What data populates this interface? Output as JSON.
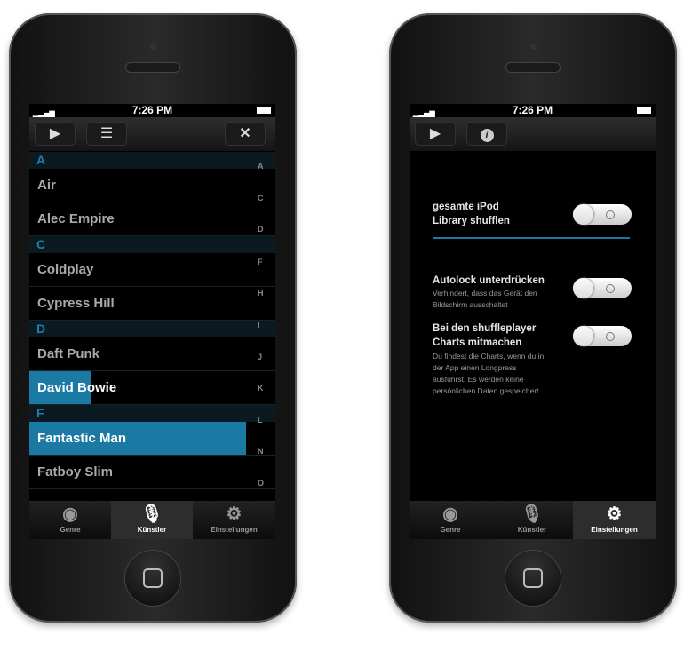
{
  "status": {
    "time": "7:26 PM"
  },
  "left": {
    "toolbar": {
      "play": "play-icon",
      "queue": "queue-icon",
      "close": "close-icon"
    },
    "headers": [
      "A",
      "C",
      "D",
      "F"
    ],
    "rows": [
      "Air",
      "Alec Empire",
      "Coldplay",
      "Cypress Hill",
      "Daft Punk",
      "David Bowie",
      "Fantastic Man",
      "Fatboy Slim"
    ],
    "index": [
      "A",
      "C",
      "D",
      "F",
      "H",
      "I",
      "J",
      "K",
      "L",
      "N",
      "O"
    ],
    "progress": {
      "David Bowie": 0.25,
      "Fantastic Man": 0.88
    },
    "accent": "#1b7aa3"
  },
  "tabs": [
    {
      "label": "Genre",
      "icon": "disc-icon"
    },
    {
      "label": "Künstler",
      "icon": "microphone-icon"
    },
    {
      "label": "Einstellungen",
      "icon": "gear-icon"
    }
  ],
  "right": {
    "settings": [
      {
        "title1": "gesamte iPod",
        "title2": "Library shufflen",
        "on": false
      },
      {
        "title1": "Autolock unterdrücken",
        "desc1": "Verhindert, dass das Gerät den",
        "desc2": "Bildschirm ausschaltet",
        "on": false
      },
      {
        "title1": "Bei den shuffleplayer",
        "title2": "Charts mitmachen",
        "desc1": "Du findest die Charts, wenn du in",
        "desc2": "der App einen Longpress",
        "desc3": "ausführst. Es werden keine",
        "desc4": "persönlichen Daten gespeichert.",
        "on": false
      }
    ]
  }
}
